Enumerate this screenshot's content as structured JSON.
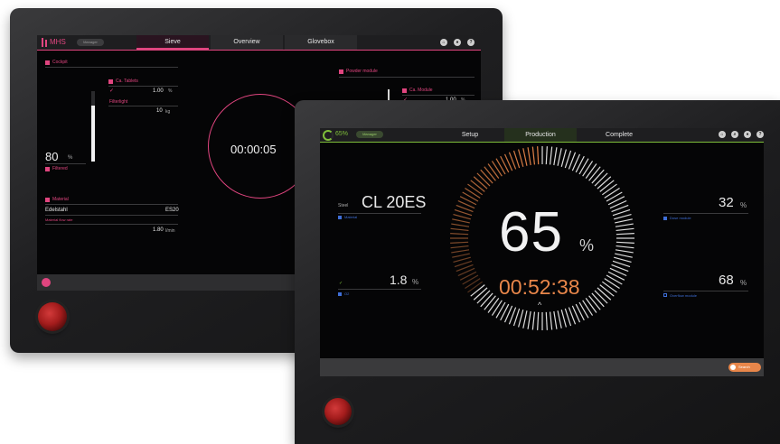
{
  "back": {
    "app_name": "MHS",
    "pill_label": "Manager",
    "tabs": [
      "Sieve",
      "Overview",
      "Glovebox"
    ],
    "header_icons": [
      "home-icon",
      "user-icon",
      "help-icon"
    ],
    "left_section_title": "Cockpit",
    "left_sub_title": "Ca. Tablets",
    "left_value_1": "1.00",
    "left_value_1_unit": "%",
    "left_sub_label": "Filterlight",
    "left_value_2": "10",
    "left_value_2_unit": "kg",
    "big_percent": "80",
    "big_percent_unit": "%",
    "big_percent_label": "Filtered",
    "right_section_title": "Powder module",
    "right_sub_title": "Ca. Module",
    "right_value_1": "1.00",
    "right_value_1_unit": "%",
    "timer": "00:00:05",
    "material_section_title": "Material",
    "material_name": "Edelstahl",
    "material_code": "ES20",
    "material_sub_label": "Material flow rate",
    "material_rate": "1.80",
    "material_rate_unit": "l/min"
  },
  "front": {
    "progress_label": "65%",
    "pill_label": "Manager",
    "tabs": [
      "Setup",
      "Production",
      "Complete"
    ],
    "active_tab_index": 1,
    "header_icons": [
      "home-icon",
      "search-icon",
      "user-icon",
      "help-icon"
    ],
    "steel_label": "Steel",
    "steel_value": "CL 20ES",
    "steel_caption": "Material",
    "o2_value": "1.8",
    "o2_unit": "%",
    "o2_caption": "O2",
    "right_top_value": "32",
    "right_top_unit": "%",
    "right_top_caption": "Dose module",
    "right_bottom_value": "68",
    "right_bottom_unit": "%",
    "right_bottom_caption": "Overflow module",
    "center_percent": "65",
    "center_percent_unit": "%",
    "center_time": "00:52:38",
    "progress_fraction": 0.65,
    "bottom_button_label": "Search"
  },
  "colors": {
    "accent_pink": "#e0457f",
    "accent_orange": "#e8864a",
    "accent_green": "#7fbf3a",
    "accent_blue": "#3f6fd8"
  }
}
